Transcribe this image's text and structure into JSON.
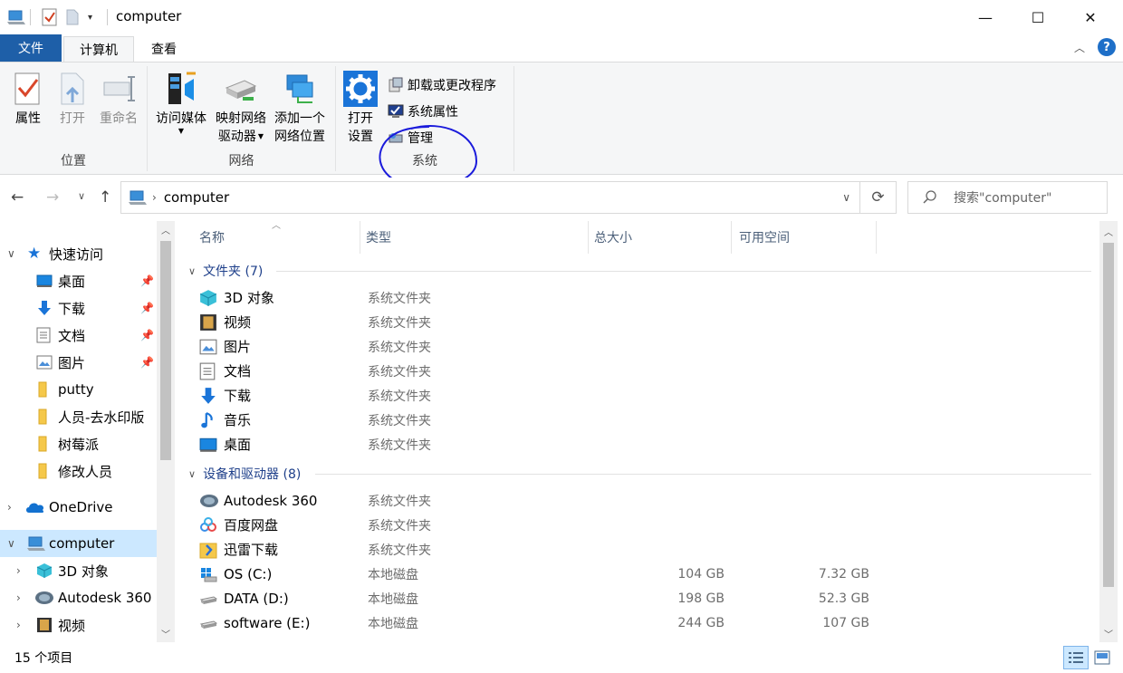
{
  "window": {
    "title": "computer",
    "minimize_glyph": "—",
    "maximize_glyph": "☐",
    "close_glyph": "✕",
    "help_glyph": "?"
  },
  "ribbon_tabs": {
    "file": "文件",
    "computer": "计算机",
    "view": "查看"
  },
  "ribbon": {
    "location_group": {
      "label": "位置",
      "properties": "属性",
      "open": "打开",
      "rename": "重命名"
    },
    "network_group": {
      "label": "网络",
      "access_media": "访问媒体",
      "map_drive_1": "映射网络",
      "map_drive_2": "驱动器",
      "add_location_1": "添加一个",
      "add_location_2": "网络位置"
    },
    "system_group": {
      "label": "系统",
      "open_settings_1": "打开",
      "open_settings_2": "设置",
      "uninstall": "卸载或更改程序",
      "system_properties": "系统属性",
      "manage": "管理"
    }
  },
  "address": {
    "path": "computer",
    "search_placeholder": "搜索\"computer\""
  },
  "nav_pane": {
    "quick_access": "快速访问",
    "items": [
      {
        "label": "桌面",
        "icon": "desktop-icon"
      },
      {
        "label": "下载",
        "icon": "download-icon"
      },
      {
        "label": "文档",
        "icon": "document-icon"
      },
      {
        "label": "图片",
        "icon": "picture-icon"
      },
      {
        "label": "putty",
        "icon": "folder-icon"
      },
      {
        "label": "人员-去水印版",
        "icon": "folder-icon"
      },
      {
        "label": "树莓派",
        "icon": "folder-icon"
      },
      {
        "label": "修改人员",
        "icon": "folder-icon"
      }
    ],
    "onedrive": "OneDrive",
    "computer": "computer",
    "computer_children": [
      {
        "label": "3D 对象",
        "icon": "cube-icon"
      },
      {
        "label": "Autodesk 360",
        "icon": "autodesk-icon"
      },
      {
        "label": "视频",
        "icon": "video-icon"
      }
    ]
  },
  "columns": {
    "name": "名称",
    "type": "类型",
    "total": "总大小",
    "free": "可用空间"
  },
  "groups": {
    "folders": {
      "header": "文件夹 (7)",
      "rows": [
        {
          "name": "3D 对象",
          "type": "系统文件夹",
          "icon": "cube-icon"
        },
        {
          "name": "视频",
          "type": "系统文件夹",
          "icon": "video-icon"
        },
        {
          "name": "图片",
          "type": "系统文件夹",
          "icon": "picture-icon"
        },
        {
          "name": "文档",
          "type": "系统文件夹",
          "icon": "document-icon"
        },
        {
          "name": "下载",
          "type": "系统文件夹",
          "icon": "download-icon"
        },
        {
          "name": "音乐",
          "type": "系统文件夹",
          "icon": "music-icon"
        },
        {
          "name": "桌面",
          "type": "系统文件夹",
          "icon": "desktop-icon"
        }
      ]
    },
    "devices": {
      "header": "设备和驱动器 (8)",
      "rows": [
        {
          "name": "Autodesk 360",
          "type": "系统文件夹",
          "total": "",
          "free": "",
          "icon": "autodesk-icon"
        },
        {
          "name": "百度网盘",
          "type": "系统文件夹",
          "total": "",
          "free": "",
          "icon": "baidu-icon"
        },
        {
          "name": "迅雷下载",
          "type": "系统文件夹",
          "total": "",
          "free": "",
          "icon": "xunlei-icon"
        },
        {
          "name": "OS (C:)",
          "type": "本地磁盘",
          "total": "104 GB",
          "free": "7.32 GB",
          "icon": "windows-drive-icon"
        },
        {
          "name": "DATA (D:)",
          "type": "本地磁盘",
          "total": "198 GB",
          "free": "52.3 GB",
          "icon": "drive-icon"
        },
        {
          "name": "software (E:)",
          "type": "本地磁盘",
          "total": "244 GB",
          "free": "107 GB",
          "icon": "drive-icon"
        }
      ]
    }
  },
  "status": {
    "count": "15 个项目"
  },
  "colors": {
    "accent": "#1e5fa8",
    "selected": "#cce8ff",
    "annotation": "#1a1adb"
  }
}
